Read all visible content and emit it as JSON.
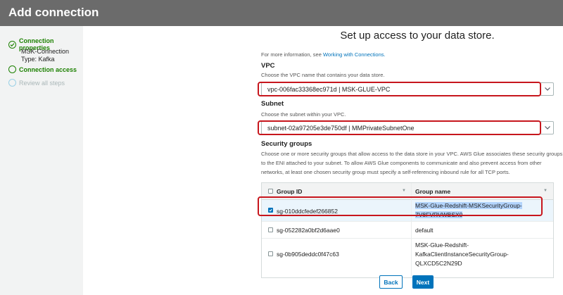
{
  "header": {
    "title": "Add connection"
  },
  "sidebar": {
    "steps": [
      {
        "label": "Connection properties",
        "sub": [
          "MSK-Connection",
          "Type: Kafka"
        ]
      },
      {
        "label": "Connection access"
      },
      {
        "label": "Review all steps"
      }
    ]
  },
  "main": {
    "title": "Set up access to your data store.",
    "info_prefix": "For more information, see ",
    "info_link": "Working with Connections.",
    "vpc": {
      "label": "VPC",
      "help": "Choose the VPC name that contains your data store.",
      "value": "vpc-006fac33368ec971d | MSK-GLUE-VPC"
    },
    "subnet": {
      "label": "Subnet",
      "help": "Choose the subnet within your VPC.",
      "value": "subnet-02a97205e3de750df | MMPrivateSubnetOne"
    },
    "security_groups": {
      "label": "Security groups",
      "help1": "Choose one or more security groups that allow access to the data store in your VPC. AWS Glue associates these security groups",
      "help2": "to the ENI attached to your subnet. To allow AWS Glue components to communicate and also prevent access from other",
      "help3": "networks, at least one chosen security group must specify a self-referencing inbound rule for all TCP ports.",
      "columns": [
        "Group ID",
        "Group name"
      ],
      "rows": [
        {
          "id": "sg-010ddcfedef266852",
          "name1": "MSK-Glue-Redshift-MSKSecurityGroup-",
          "name2": "7V8FVRVWBSX0",
          "checked": true
        },
        {
          "id": "sg-052282a0bf2d6aae0",
          "name1": "default",
          "checked": false
        },
        {
          "id": "sg-0b905deddc0f47c63",
          "name1": "MSK-Glue-Redshift-",
          "name2": "KafkaClientInstanceSecurityGroup-",
          "name3": "QLXCD5C2N29D",
          "checked": false
        }
      ]
    },
    "buttons": {
      "back": "Back",
      "next": "Next"
    }
  },
  "colors": {
    "header": "#6b6b6b",
    "accent": "#0073bb",
    "success": "#1d8102",
    "highlight": "#c7161d"
  }
}
